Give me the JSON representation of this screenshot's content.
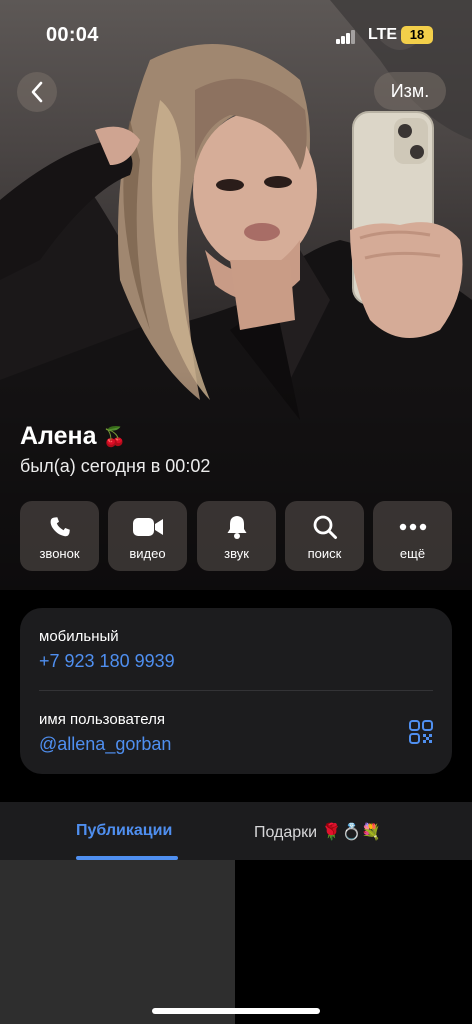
{
  "status_bar": {
    "time": "00:04",
    "network": "LTE",
    "battery": "18"
  },
  "header": {
    "edit_label": "Изм."
  },
  "profile": {
    "name": "Алена",
    "name_emoji": "🍒",
    "last_seen": "был(а) сегодня в 00:02"
  },
  "actions": [
    {
      "label": "звонок",
      "icon": "phone-icon"
    },
    {
      "label": "видео",
      "icon": "video-camera-icon"
    },
    {
      "label": "звук",
      "icon": "bell-icon"
    },
    {
      "label": "поиск",
      "icon": "search-icon"
    },
    {
      "label": "ещё",
      "icon": "more-dots-icon"
    }
  ],
  "info": {
    "phone_label": "мобильный",
    "phone_value": "+7 923 180 9939",
    "username_label": "имя пользователя",
    "username_value": "@allena_gorban"
  },
  "tabs": [
    {
      "label": "Публикации",
      "active": true
    },
    {
      "label": "Подарки 🌹💍💐",
      "active": false
    }
  ],
  "colors": {
    "accent": "#4f8ff0",
    "card_bg": "#1c1c1e",
    "battery": "#f3cf4a"
  }
}
